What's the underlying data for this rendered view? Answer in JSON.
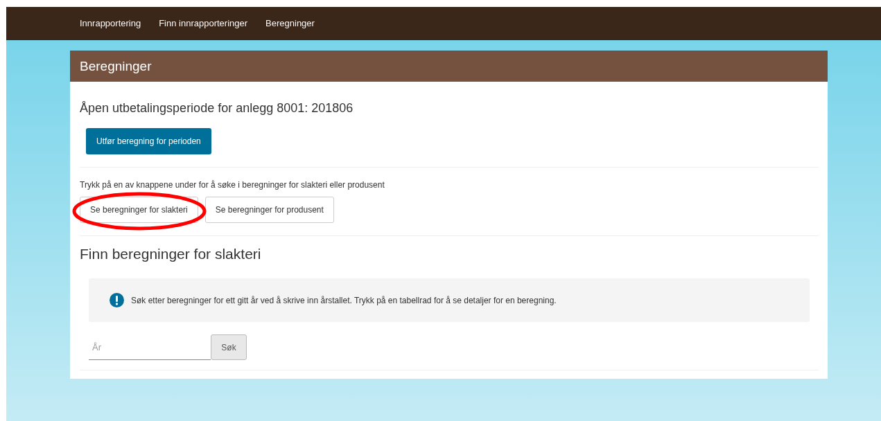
{
  "nav": {
    "items": [
      {
        "label": "Innrapportering"
      },
      {
        "label": "Finn innrapporteringer"
      },
      {
        "label": "Beregninger"
      }
    ]
  },
  "panel": {
    "title": "Beregninger",
    "period_heading": "Åpen utbetalingsperiode for anlegg 8001: 201806",
    "run_button": "Utfør beregning for perioden",
    "instruction": "Trykk på en av knappene under for å søke i beregninger for slakteri eller produsent",
    "choice_buttons": [
      {
        "label": "Se beregninger for slakteri",
        "highlighted": true
      },
      {
        "label": "Se beregninger for produsent",
        "highlighted": false
      }
    ],
    "search_heading": "Finn beregninger for slakteri",
    "info": "Søk etter beregninger for ett gitt år ved å skrive inn årstallet. Trykk på en tabellrad for å se detaljer for en beregning.",
    "year_field": {
      "placeholder": "År"
    },
    "search_button": "Søk"
  }
}
